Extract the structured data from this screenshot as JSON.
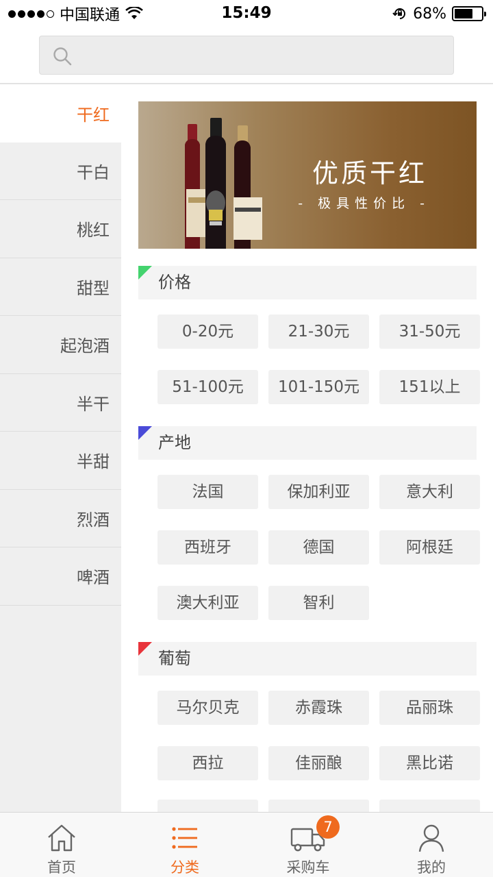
{
  "status_bar": {
    "carrier": "中国联通",
    "time": "15:49",
    "battery": "68%",
    "battery_level": 0.68,
    "icons": [
      "signal-dots-icon",
      "wifi-icon",
      "rotation-lock-icon",
      "battery-icon"
    ]
  },
  "search": {
    "placeholder": "",
    "icon": "search-icon"
  },
  "sidebar": {
    "items": [
      {
        "label": "干红",
        "active": true
      },
      {
        "label": "干白"
      },
      {
        "label": "桃红"
      },
      {
        "label": "甜型"
      },
      {
        "label": "起泡酒"
      },
      {
        "label": "半干"
      },
      {
        "label": "半甜"
      },
      {
        "label": "烈酒"
      },
      {
        "label": "啤酒"
      }
    ]
  },
  "banner": {
    "title": "优质干红",
    "subtitle": "- 极具性价比 -",
    "accent": "#8a6030"
  },
  "sections": [
    {
      "title": "价格",
      "corner_color": "#44d36e",
      "tags": [
        "0-20元",
        "21-30元",
        "31-50元",
        "51-100元",
        "101-150元",
        "151以上"
      ]
    },
    {
      "title": "产地",
      "corner_color": "#4a4bd8",
      "tags": [
        "法国",
        "保加利亚",
        "意大利",
        "西班牙",
        "德国",
        "阿根廷",
        "澳大利亚",
        "智利"
      ]
    },
    {
      "title": "葡萄",
      "corner_color": "#e8343b",
      "tags": [
        "马尔贝克",
        "赤霞珠",
        "品丽珠",
        "西拉",
        "佳丽酿",
        "黑比诺"
      ]
    }
  ],
  "tabbar": {
    "tabs": [
      {
        "label": "首页",
        "icon": "home-icon"
      },
      {
        "label": "分类",
        "icon": "category-list-icon",
        "active": true
      },
      {
        "label": "采购车",
        "icon": "truck-cart-icon",
        "badge": "7"
      },
      {
        "label": "我的",
        "icon": "user-icon"
      }
    ]
  },
  "colors": {
    "accent": "#ef6a1e",
    "badge": "#ef6a1e"
  }
}
